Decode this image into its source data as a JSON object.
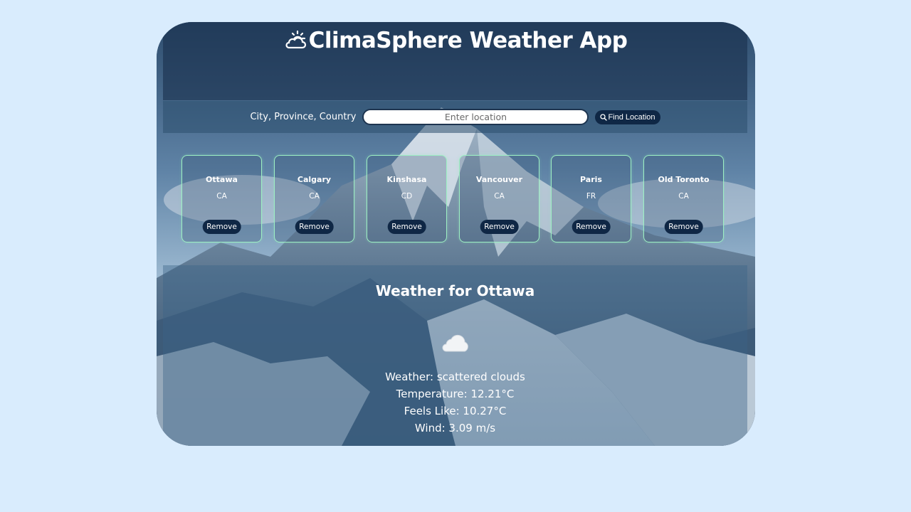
{
  "app": {
    "title": "ClimaSphere Weather App",
    "title_icon": "sun-cloud-icon"
  },
  "search": {
    "label": "City, Province, Country",
    "placeholder": "Enter location",
    "value": "",
    "button_label": "Find Location",
    "button_icon": "search-icon"
  },
  "cards": [
    {
      "city": "Ottawa",
      "country": "CA",
      "remove_label": "Remove"
    },
    {
      "city": "Calgary",
      "country": "CA",
      "remove_label": "Remove"
    },
    {
      "city": "Kinshasa",
      "country": "CD",
      "remove_label": "Remove"
    },
    {
      "city": "Vancouver",
      "country": "CA",
      "remove_label": "Remove"
    },
    {
      "city": "Paris",
      "country": "FR",
      "remove_label": "Remove"
    },
    {
      "city": "Old Toronto",
      "country": "CA",
      "remove_label": "Remove"
    }
  ],
  "weather": {
    "heading": "Weather for Ottawa",
    "icon": "cloud-icon",
    "condition": "Weather: scattered clouds",
    "temperature": "Temperature: 12.21°C",
    "feels_like": "Feels Like: 10.27°C",
    "wind": "Wind: 3.09 m/s"
  },
  "colors": {
    "page_background": "#d9ecfd",
    "button_background": "#0f2745",
    "card_border": "#9ef0c3"
  }
}
